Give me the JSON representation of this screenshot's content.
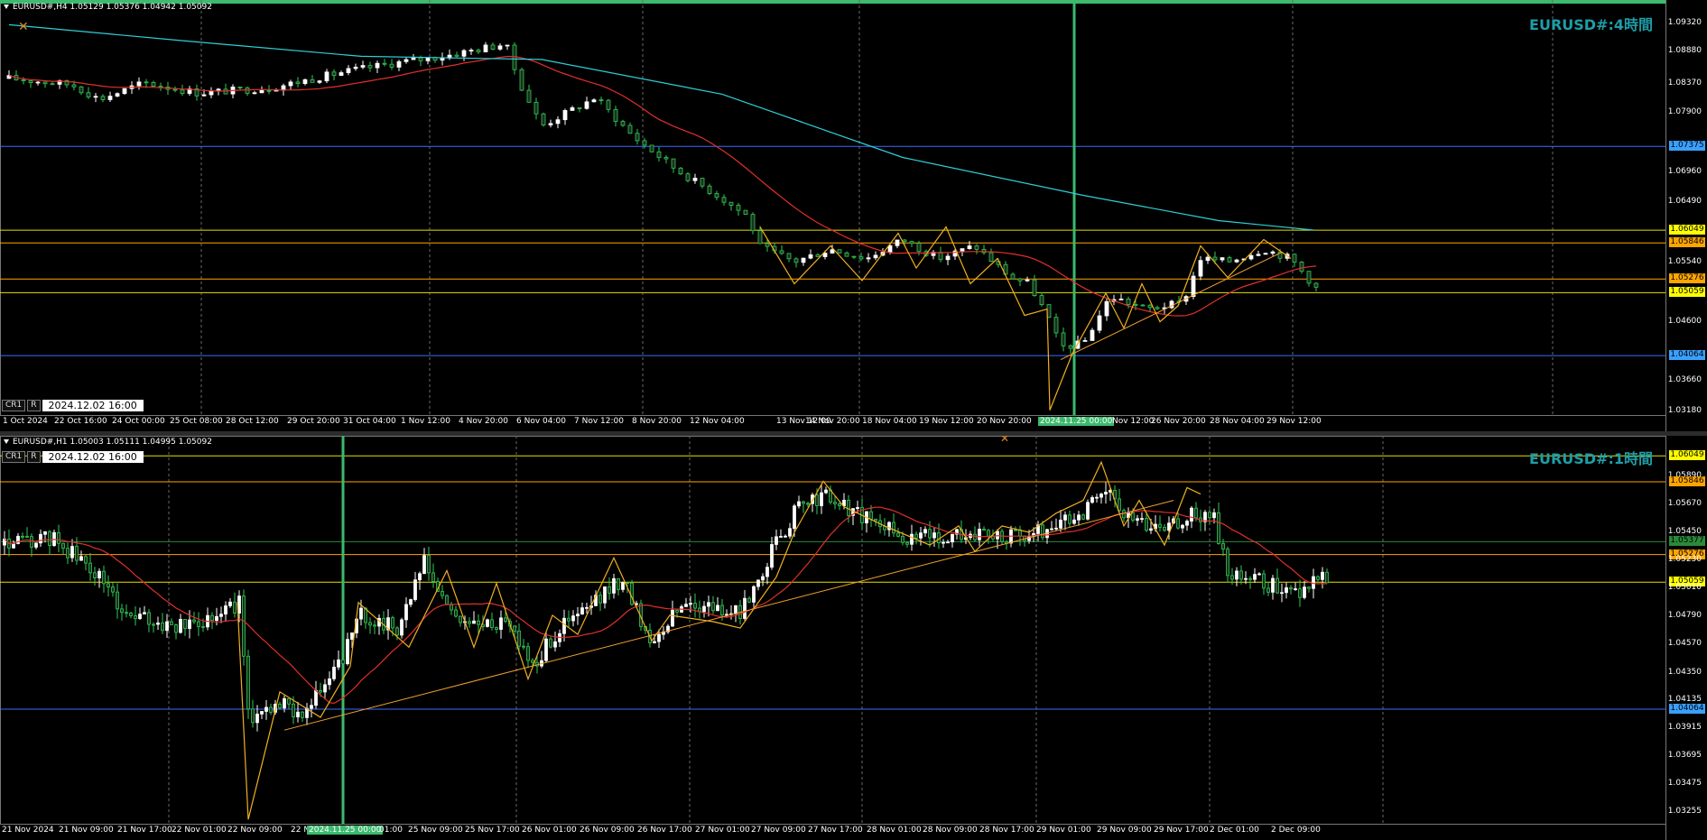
{
  "h4": {
    "symbol_line": "EURUSD#,H4  1.05129 1.05376 1.04942 1.05092",
    "title": "EURUSD#:4時間",
    "cr_label": "CR1",
    "r_label": "R",
    "datetime_box": "2024.12.02 16:00",
    "cursor_time_label": "2024.11.25 00:00",
    "price_axis": [
      "1.09320",
      "1.08880",
      "1.08370",
      "1.07900",
      "1.07375",
      "1.06960",
      "1.06490",
      "1.06049",
      "1.05846",
      "1.05540",
      "1.05276",
      "1.05059",
      "1.04600",
      "1.04064",
      "1.03660",
      "1.03180"
    ],
    "time_axis": [
      "1 Oct 2024",
      "22 Oct 16:00",
      "24 Oct 00:00",
      "25 Oct 08:00",
      "28 Oct 12:00",
      "29 Oct 20:00",
      "31 Oct 04:00",
      "1 Nov 12:00",
      "4 Nov 20:00",
      "6 Nov 04:00",
      "7 Nov 12:00",
      "8 Nov 20:00",
      "12 Nov 04:00",
      "13 Nov 12:00",
      "14 Nov 20:00",
      "18 Nov 04:00",
      "19 Nov 12:00",
      "20 Nov 20:00",
      "2024.11.25 00:00",
      "Nov 12:00",
      "26 Nov 20:00",
      "28 Nov 04:00",
      "29 Nov 12:00"
    ],
    "level_tags": [
      {
        "value": "1.07375",
        "color": "#3aa0ff"
      },
      {
        "value": "1.06049",
        "color": "#ffff00"
      },
      {
        "value": "1.05846",
        "color": "#ffa500"
      },
      {
        "value": "1.05276",
        "color": "#ffa500"
      },
      {
        "value": "1.05059",
        "color": "#ffff00"
      },
      {
        "value": "1.04064",
        "color": "#3aa0ff"
      }
    ]
  },
  "h1": {
    "symbol_line": "EURUSD#,H1  1.05003 1.05111 1.04995 1.05092",
    "title": "EURUSD#:1時間",
    "cr_label": "CR1",
    "r_label": "R",
    "datetime_box": "2024.12.02 16:00",
    "cursor_time_label": "2024.11.25 00:00",
    "price_axis": [
      "1.06049",
      "1.05890",
      "1.05846",
      "1.05670",
      "1.05450",
      "1.05377",
      "1.05276",
      "1.05230",
      "1.05059",
      "1.05010",
      "1.04790",
      "1.04570",
      "1.04350",
      "1.04135",
      "1.04064",
      "1.03915",
      "1.03695",
      "1.03475",
      "1.03255"
    ],
    "time_axis": [
      "21 Nov 2024",
      "21 Nov 09:00",
      "21 Nov 17:00",
      "22 Nov 01:00",
      "22 Nov 09:00",
      "22 N",
      "2024.11.25 00:00",
      "01:00",
      "25 Nov 09:00",
      "25 Nov 17:00",
      "26 Nov 01:00",
      "26 Nov 09:00",
      "26 Nov 17:00",
      "27 Nov 01:00",
      "27 Nov 09:00",
      "27 Nov 17:00",
      "28 Nov 01:00",
      "28 Nov 09:00",
      "28 Nov 17:00",
      "29 Nov 01:00",
      "29 Nov 09:00",
      "29 Nov 17:00",
      "2 Dec 01:00",
      "2 Dec 09:00"
    ],
    "level_tags": [
      {
        "value": "1.06049",
        "color": "#ffff00"
      },
      {
        "value": "1.05846",
        "color": "#ffa500"
      },
      {
        "value": "1.05377",
        "color": "#2a8a3a"
      },
      {
        "value": "1.05276",
        "color": "#ffa500"
      },
      {
        "value": "1.05059",
        "color": "#ffff00"
      },
      {
        "value": "1.04064",
        "color": "#3aa0ff"
      }
    ]
  }
}
